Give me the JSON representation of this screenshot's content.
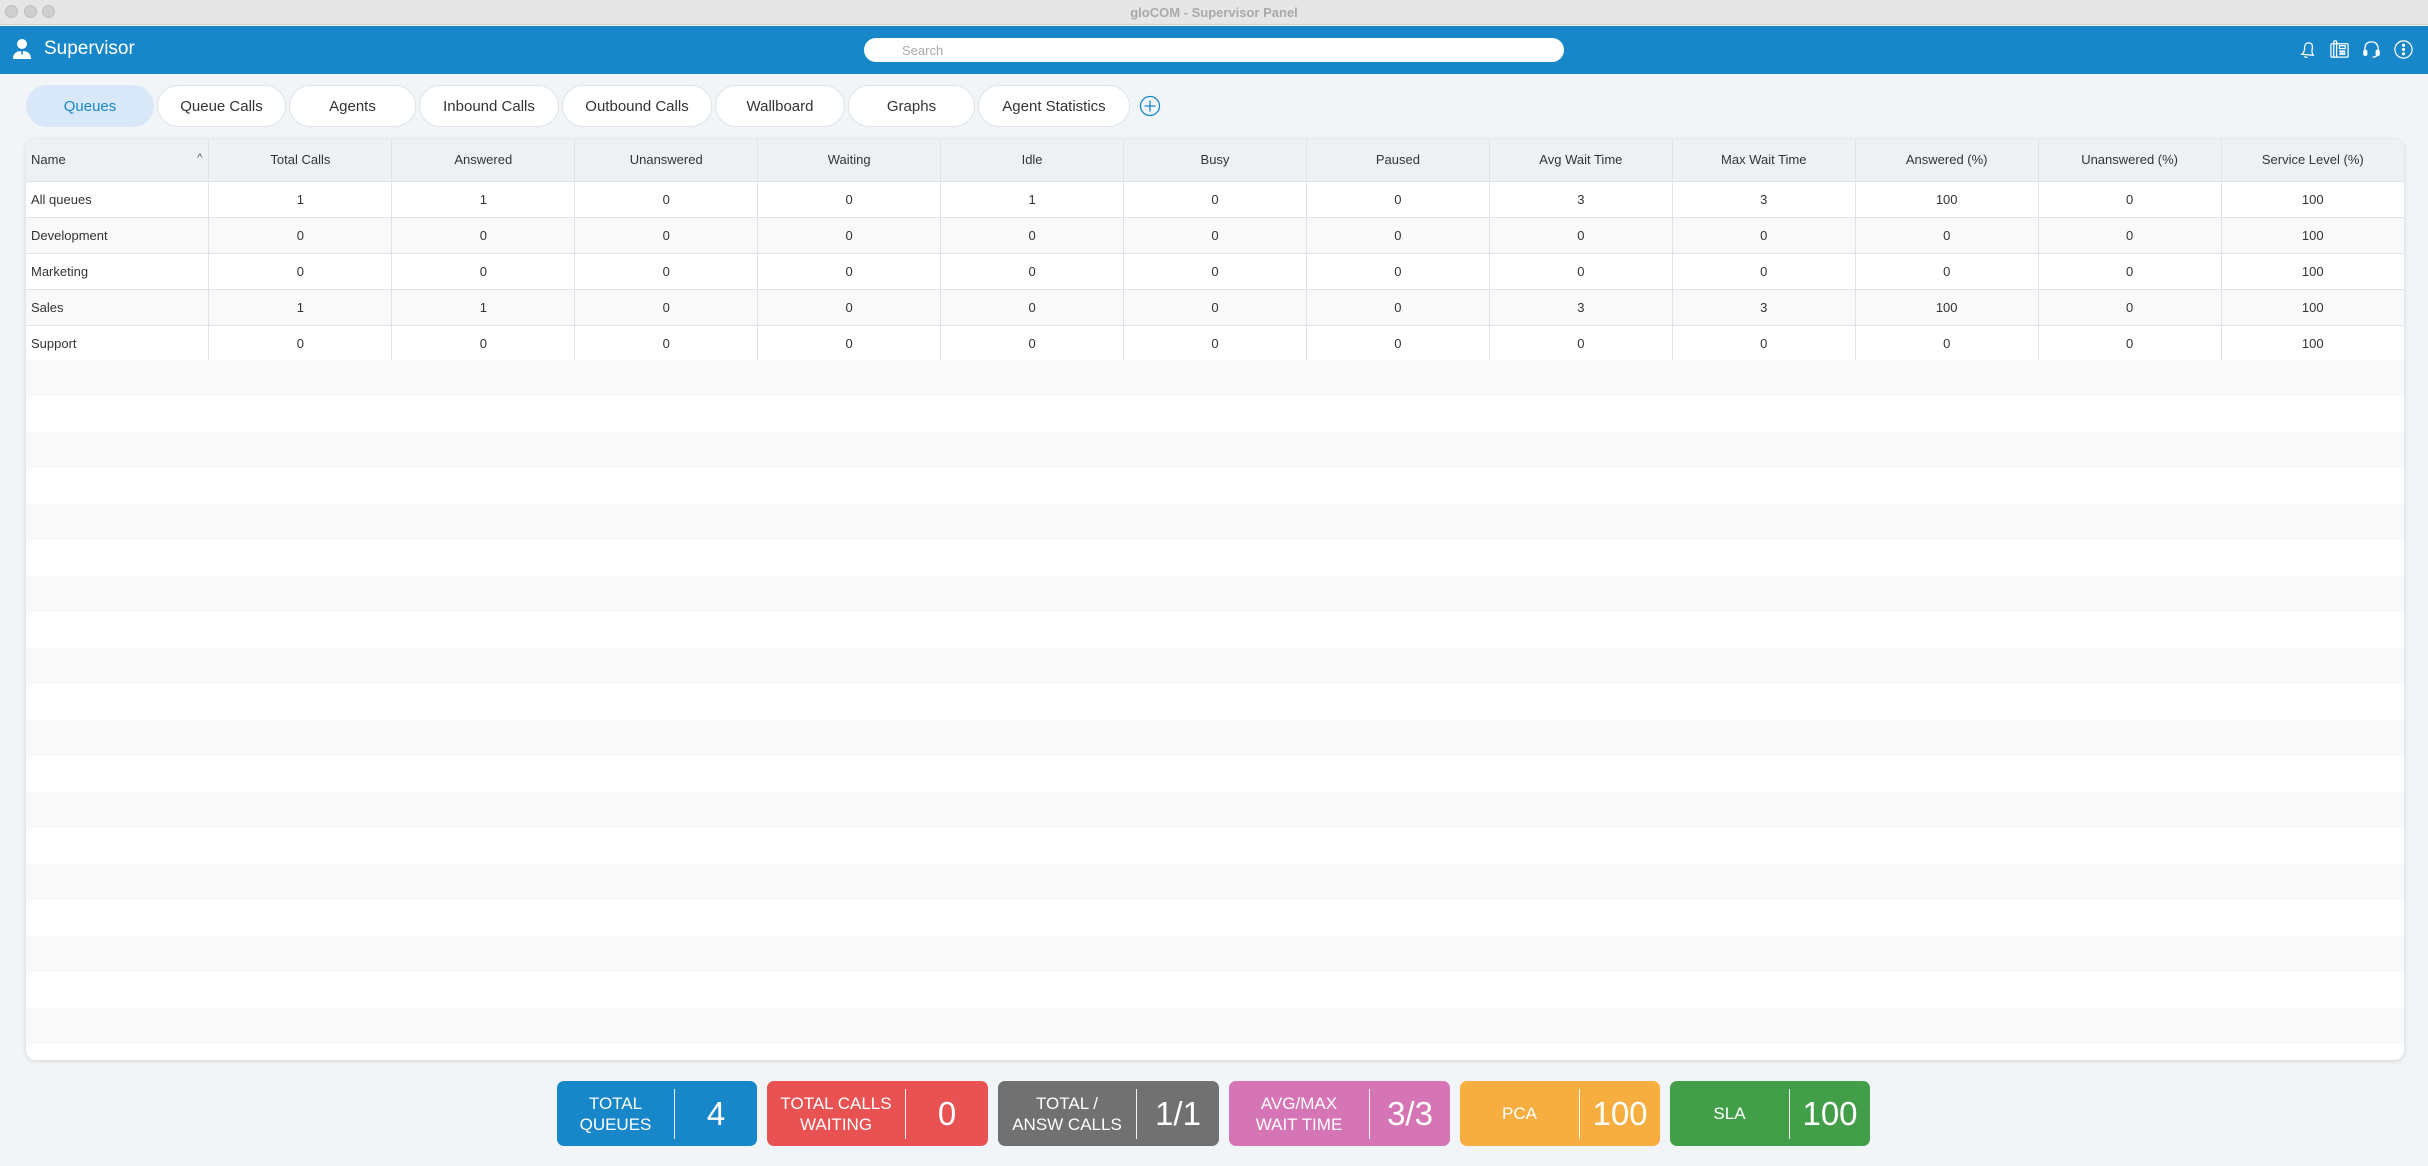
{
  "window": {
    "title": "gloCOM - Supervisor Panel"
  },
  "header": {
    "app_name": "Supervisor",
    "search_placeholder": "Search",
    "search_value": "",
    "icons": [
      "bell-icon",
      "desk-phone-icon",
      "headset-icon",
      "info-more-icon"
    ]
  },
  "tabs": [
    {
      "label": "Queues",
      "active": true
    },
    {
      "label": "Queue Calls",
      "active": false
    },
    {
      "label": "Agents",
      "active": false
    },
    {
      "label": "Inbound Calls",
      "active": false
    },
    {
      "label": "Outbound Calls",
      "active": false
    },
    {
      "label": "Wallboard",
      "active": false
    },
    {
      "label": "Graphs",
      "active": false
    },
    {
      "label": "Agent Statistics",
      "active": false
    }
  ],
  "table": {
    "sort_indicator": "^",
    "columns": [
      "Name",
      "Total Calls",
      "Answered",
      "Unanswered",
      "Waiting",
      "Idle",
      "Busy",
      "Paused",
      "Avg Wait Time",
      "Max Wait Time",
      "Answered (%)",
      "Unanswered (%)",
      "Service Level (%)"
    ],
    "rows": [
      [
        "All queues",
        "1",
        "1",
        "0",
        "0",
        "1",
        "0",
        "0",
        "3",
        "3",
        "100",
        "0",
        "100"
      ],
      [
        "Development",
        "0",
        "0",
        "0",
        "0",
        "0",
        "0",
        "0",
        "0",
        "0",
        "0",
        "0",
        "100"
      ],
      [
        "Marketing",
        "0",
        "0",
        "0",
        "0",
        "0",
        "0",
        "0",
        "0",
        "0",
        "0",
        "0",
        "100"
      ],
      [
        "Sales",
        "1",
        "1",
        "0",
        "0",
        "0",
        "0",
        "0",
        "3",
        "3",
        "100",
        "0",
        "100"
      ],
      [
        "Support",
        "0",
        "0",
        "0",
        "0",
        "0",
        "0",
        "0",
        "0",
        "0",
        "0",
        "0",
        "100"
      ]
    ]
  },
  "stats": [
    {
      "label": "TOTAL\nQUEUES",
      "value": "4",
      "color": "#1787c9"
    },
    {
      "label": "TOTAL CALLS\nWAITING",
      "value": "0",
      "color": "#e95253"
    },
    {
      "label": "TOTAL /\nANSW CALLS",
      "value": "1/1",
      "color": "#717171"
    },
    {
      "label": "AVG/MAX\nWAIT TIME",
      "value": "3/3",
      "color": "#d675b6"
    },
    {
      "label": "PCA",
      "value": "100",
      "color": "#f7ae41"
    },
    {
      "label": "SLA",
      "value": "100",
      "color": "#429e48"
    }
  ]
}
